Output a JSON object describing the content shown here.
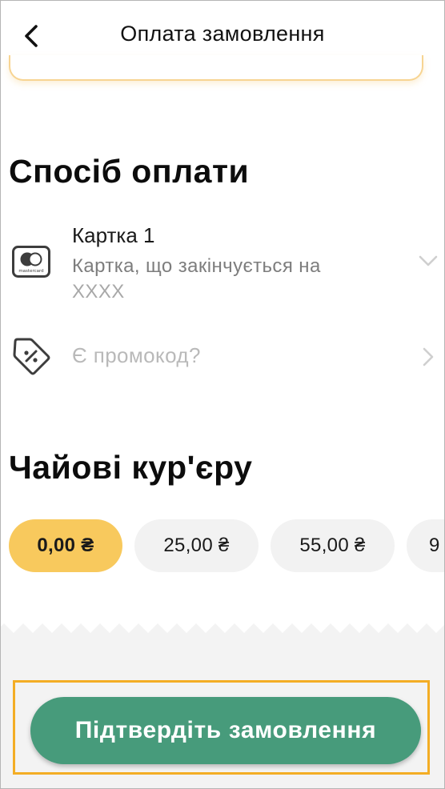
{
  "header": {
    "title": "Оплата замовлення",
    "back_icon": "back-arrow-icon"
  },
  "payment": {
    "section_title": "Спосіб оплати",
    "card_icon": "mastercard-icon",
    "card_brand_text": "mastercard",
    "card_name": "Картка 1",
    "card_desc": "Картка, що закінчується на",
    "card_mask": "XXXX",
    "expand_icon": "chevron-down-icon"
  },
  "promo": {
    "icon": "discount-tag-icon",
    "placeholder": "Є промокод?",
    "arrow_icon": "chevron-right-icon"
  },
  "tips": {
    "section_title": "Чайові кур'єру",
    "options": [
      "0,00 ₴",
      "25,00 ₴",
      "55,00 ₴",
      "9"
    ],
    "selected_index": 0
  },
  "confirm": {
    "label": "Підтвердіть замовлення"
  },
  "colors": {
    "accent": "#f8c95d",
    "primary_button": "#479b7b",
    "highlight_outline": "#f3ad25"
  }
}
